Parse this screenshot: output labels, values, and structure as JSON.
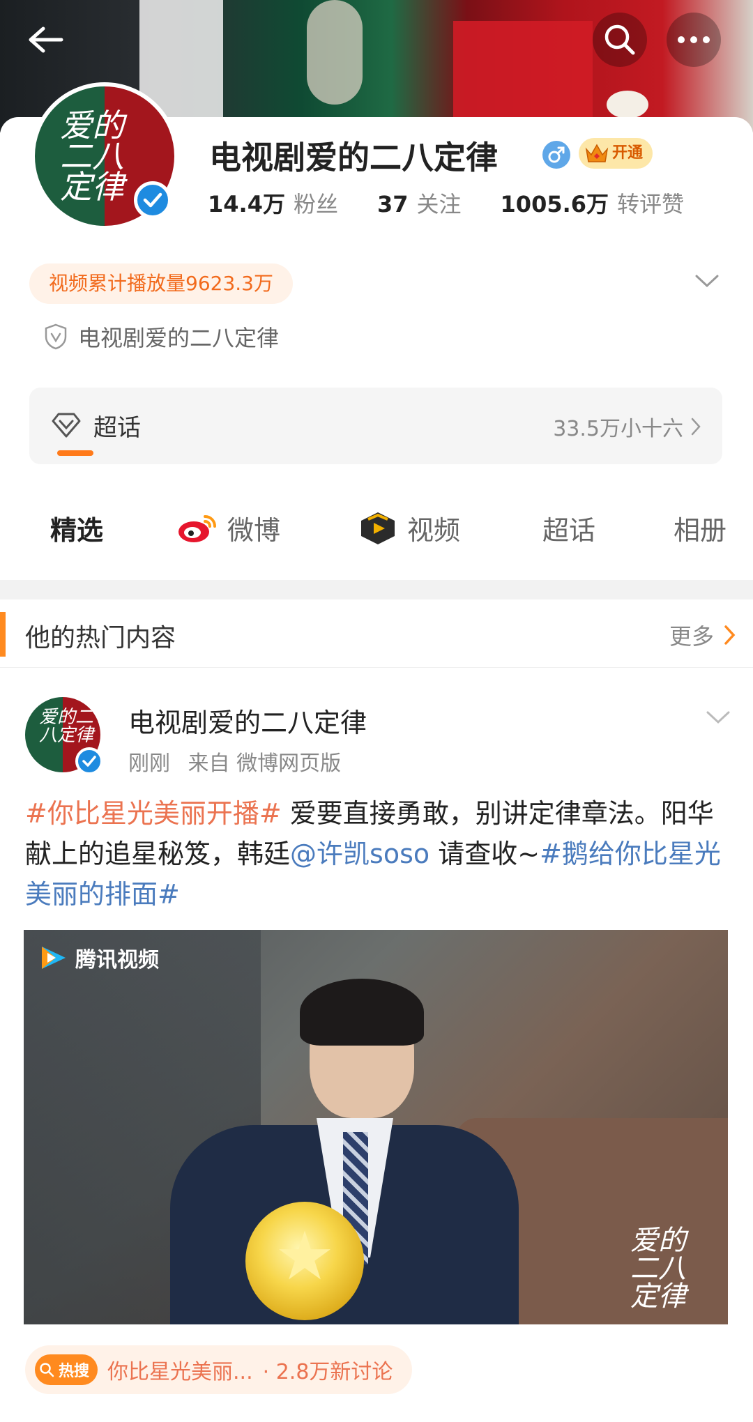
{
  "profile": {
    "name": "电视剧爱的二八定律",
    "avatar_text": "爱的二八定律",
    "vip_label": "开通",
    "stats": [
      {
        "num": "14.4万",
        "label": "粉丝"
      },
      {
        "num": "37",
        "label": "关注"
      },
      {
        "num": "1005.6万",
        "label": "转评赞"
      }
    ],
    "play_count": "视频累计播放量9623.3万",
    "identity": "电视剧爱的二八定律"
  },
  "topic": {
    "label": "超话",
    "right_text": "33.5万小十六"
  },
  "tabs": [
    {
      "label": "精选"
    },
    {
      "label": "微博"
    },
    {
      "label": "视频"
    },
    {
      "label": "超话"
    },
    {
      "label": "相册"
    }
  ],
  "hot": {
    "title": "他的热门内容",
    "more": "更多"
  },
  "post": {
    "author": "电视剧爱的二八定律",
    "time": "刚刚",
    "source": "来自 微博网页版",
    "text_tag1": "#你比星光美丽开播#",
    "text_1": " 爱要直接勇敢，别讲定律章法。阳华献上的追星秘笈，韩廷",
    "mention": "@许凯soso",
    "text_2": " 请查收~",
    "text_tag2": "#鹅给你比星光美丽的排面#",
    "video_brand": "腾讯视频",
    "watermark": "爱的二八定律"
  },
  "hot_search": {
    "badge": "热搜",
    "title": "你比星光美丽...",
    "count": "· 2.8万新讨论"
  },
  "colors": {
    "accent": "#ff8a1f",
    "link": "#4a7bbd",
    "topic": "#eb7350",
    "verify": "#1e8be0"
  }
}
